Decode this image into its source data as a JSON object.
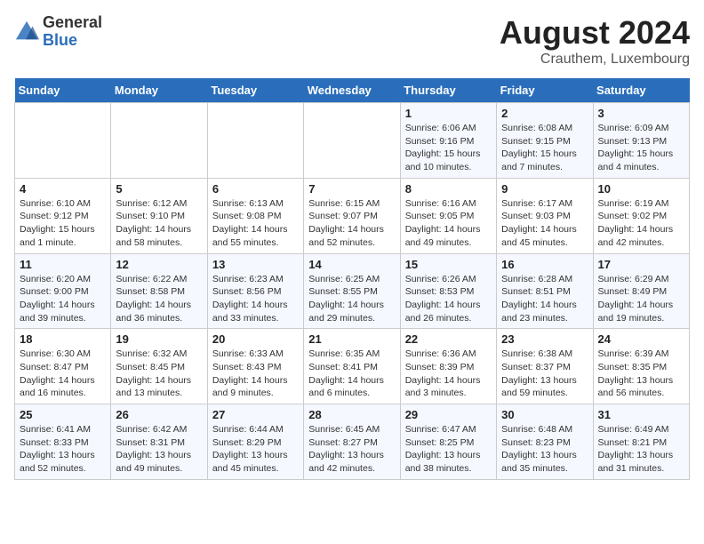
{
  "logo": {
    "general": "General",
    "blue": "Blue"
  },
  "title": "August 2024",
  "location": "Crauthem, Luxembourg",
  "days_of_week": [
    "Sunday",
    "Monday",
    "Tuesday",
    "Wednesday",
    "Thursday",
    "Friday",
    "Saturday"
  ],
  "weeks": [
    [
      {
        "day": "",
        "info": ""
      },
      {
        "day": "",
        "info": ""
      },
      {
        "day": "",
        "info": ""
      },
      {
        "day": "",
        "info": ""
      },
      {
        "day": "1",
        "info": "Sunrise: 6:06 AM\nSunset: 9:16 PM\nDaylight: 15 hours\nand 10 minutes."
      },
      {
        "day": "2",
        "info": "Sunrise: 6:08 AM\nSunset: 9:15 PM\nDaylight: 15 hours\nand 7 minutes."
      },
      {
        "day": "3",
        "info": "Sunrise: 6:09 AM\nSunset: 9:13 PM\nDaylight: 15 hours\nand 4 minutes."
      }
    ],
    [
      {
        "day": "4",
        "info": "Sunrise: 6:10 AM\nSunset: 9:12 PM\nDaylight: 15 hours\nand 1 minute."
      },
      {
        "day": "5",
        "info": "Sunrise: 6:12 AM\nSunset: 9:10 PM\nDaylight: 14 hours\nand 58 minutes."
      },
      {
        "day": "6",
        "info": "Sunrise: 6:13 AM\nSunset: 9:08 PM\nDaylight: 14 hours\nand 55 minutes."
      },
      {
        "day": "7",
        "info": "Sunrise: 6:15 AM\nSunset: 9:07 PM\nDaylight: 14 hours\nand 52 minutes."
      },
      {
        "day": "8",
        "info": "Sunrise: 6:16 AM\nSunset: 9:05 PM\nDaylight: 14 hours\nand 49 minutes."
      },
      {
        "day": "9",
        "info": "Sunrise: 6:17 AM\nSunset: 9:03 PM\nDaylight: 14 hours\nand 45 minutes."
      },
      {
        "day": "10",
        "info": "Sunrise: 6:19 AM\nSunset: 9:02 PM\nDaylight: 14 hours\nand 42 minutes."
      }
    ],
    [
      {
        "day": "11",
        "info": "Sunrise: 6:20 AM\nSunset: 9:00 PM\nDaylight: 14 hours\nand 39 minutes."
      },
      {
        "day": "12",
        "info": "Sunrise: 6:22 AM\nSunset: 8:58 PM\nDaylight: 14 hours\nand 36 minutes."
      },
      {
        "day": "13",
        "info": "Sunrise: 6:23 AM\nSunset: 8:56 PM\nDaylight: 14 hours\nand 33 minutes."
      },
      {
        "day": "14",
        "info": "Sunrise: 6:25 AM\nSunset: 8:55 PM\nDaylight: 14 hours\nand 29 minutes."
      },
      {
        "day": "15",
        "info": "Sunrise: 6:26 AM\nSunset: 8:53 PM\nDaylight: 14 hours\nand 26 minutes."
      },
      {
        "day": "16",
        "info": "Sunrise: 6:28 AM\nSunset: 8:51 PM\nDaylight: 14 hours\nand 23 minutes."
      },
      {
        "day": "17",
        "info": "Sunrise: 6:29 AM\nSunset: 8:49 PM\nDaylight: 14 hours\nand 19 minutes."
      }
    ],
    [
      {
        "day": "18",
        "info": "Sunrise: 6:30 AM\nSunset: 8:47 PM\nDaylight: 14 hours\nand 16 minutes."
      },
      {
        "day": "19",
        "info": "Sunrise: 6:32 AM\nSunset: 8:45 PM\nDaylight: 14 hours\nand 13 minutes."
      },
      {
        "day": "20",
        "info": "Sunrise: 6:33 AM\nSunset: 8:43 PM\nDaylight: 14 hours\nand 9 minutes."
      },
      {
        "day": "21",
        "info": "Sunrise: 6:35 AM\nSunset: 8:41 PM\nDaylight: 14 hours\nand 6 minutes."
      },
      {
        "day": "22",
        "info": "Sunrise: 6:36 AM\nSunset: 8:39 PM\nDaylight: 14 hours\nand 3 minutes."
      },
      {
        "day": "23",
        "info": "Sunrise: 6:38 AM\nSunset: 8:37 PM\nDaylight: 13 hours\nand 59 minutes."
      },
      {
        "day": "24",
        "info": "Sunrise: 6:39 AM\nSunset: 8:35 PM\nDaylight: 13 hours\nand 56 minutes."
      }
    ],
    [
      {
        "day": "25",
        "info": "Sunrise: 6:41 AM\nSunset: 8:33 PM\nDaylight: 13 hours\nand 52 minutes."
      },
      {
        "day": "26",
        "info": "Sunrise: 6:42 AM\nSunset: 8:31 PM\nDaylight: 13 hours\nand 49 minutes."
      },
      {
        "day": "27",
        "info": "Sunrise: 6:44 AM\nSunset: 8:29 PM\nDaylight: 13 hours\nand 45 minutes."
      },
      {
        "day": "28",
        "info": "Sunrise: 6:45 AM\nSunset: 8:27 PM\nDaylight: 13 hours\nand 42 minutes."
      },
      {
        "day": "29",
        "info": "Sunrise: 6:47 AM\nSunset: 8:25 PM\nDaylight: 13 hours\nand 38 minutes."
      },
      {
        "day": "30",
        "info": "Sunrise: 6:48 AM\nSunset: 8:23 PM\nDaylight: 13 hours\nand 35 minutes."
      },
      {
        "day": "31",
        "info": "Sunrise: 6:49 AM\nSunset: 8:21 PM\nDaylight: 13 hours\nand 31 minutes."
      }
    ]
  ]
}
